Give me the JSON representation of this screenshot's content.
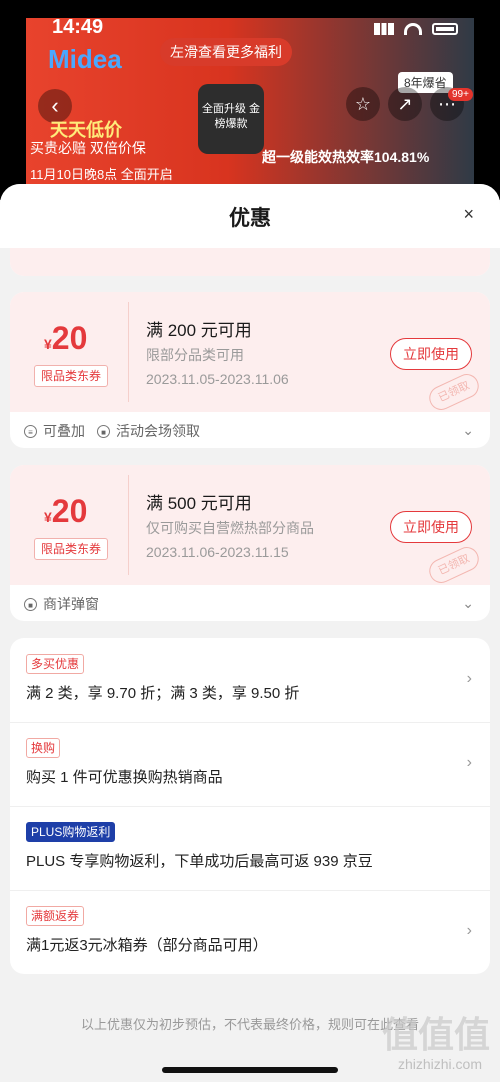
{
  "status": {
    "time": "14:49"
  },
  "hero": {
    "brand": "Midea",
    "slide_tip": "左滑查看更多福利",
    "promo_title": "天天低价",
    "promo_line1": "买贵必赔 双倍价保",
    "promo_line2": "11月10日晚8点 全面开启",
    "badge_center": "全面升级 金榜爆款",
    "energy_label": "8年爆省",
    "efficiency": "超一级能效热效率104.81%",
    "cart_badge": "99+"
  },
  "sheet": {
    "title": "优惠",
    "close": "×"
  },
  "coupons": [
    {
      "currency": "¥",
      "amount": "20",
      "tag": "限品类东券",
      "condition": "满 200 元可用",
      "limit": "限部分品类可用",
      "period": "2023.11.05-2023.11.06",
      "button": "立即使用",
      "stamp": "已领取",
      "foot": [
        {
          "icon": "stackable-icon",
          "label": "可叠加"
        },
        {
          "icon": "venue-icon",
          "label": "活动会场领取"
        }
      ]
    },
    {
      "currency": "¥",
      "amount": "20",
      "tag": "限品类东券",
      "condition": "满 500 元可用",
      "limit": "仅可购买自营燃热部分商品",
      "period": "2023.11.06-2023.11.15",
      "button": "立即使用",
      "stamp": "已领取",
      "foot": [
        {
          "icon": "popup-icon",
          "label": "商详弹窗"
        }
      ]
    }
  ],
  "offers": [
    {
      "tag": "多买优惠",
      "text": "满 2 类，享 9.70 折；满 3 类，享 9.50 折",
      "plus": false
    },
    {
      "tag": "换购",
      "text": "购买 1 件可优惠换购热销商品",
      "plus": false
    },
    {
      "tag": "PLUS购物返利",
      "text": "PLUS 专享购物返利，下单成功后最高可返 939 京豆",
      "plus": true
    },
    {
      "tag": "满额返券",
      "text": "满1元返3元冰箱券（部分商品可用）",
      "plus": false
    }
  ],
  "disclaimer": "以上优惠仅为初步预估，不代表最终价格，规则可在此查看",
  "watermark": {
    "mark": "值值值",
    "site": "zhizhizhi.com"
  }
}
